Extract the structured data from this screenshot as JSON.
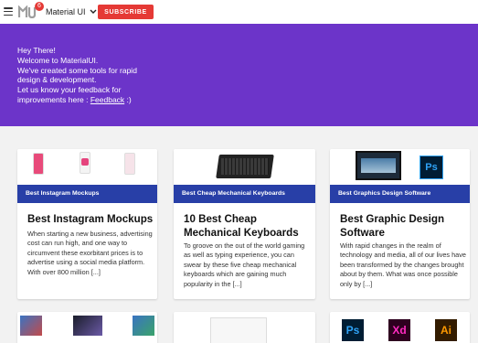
{
  "header": {
    "menu_icon": "hamburger-icon",
    "logo_icon": "mui-logo-icon",
    "badge_count": "6",
    "brand_label": "Material UI",
    "subscribe_label": "SUBSCRIBE",
    "accent_color": "#e53935"
  },
  "hero": {
    "line1": "Hey There!",
    "line2": "Welcome to MaterialUI.",
    "line3": "We've created some tools for rapid",
    "line4": "design & development.",
    "line5": "Let us know your feedback for",
    "line6_prefix": "improvements here : ",
    "feedback_link": "Feedback",
    "line6_suffix": " :)",
    "background": "#6c34c9"
  },
  "cards": [
    {
      "category": "Best Instagram Mockups",
      "title": "Best Instagram Mockups",
      "excerpt": "When starting a new business, advertising cost can run high, and one way to circumvent these exorbitant prices is to advertise using a social media platform. With over 800 million [...]"
    },
    {
      "category": "Best Cheap Mechanical Keyboards",
      "title": "10 Best Cheap Mechanical Keyboards",
      "excerpt": "To groove on the out of the world gaming as well as typing experience, you can swear by these five cheap mechanical keyboards which are gaining much popularity in the [...]"
    },
    {
      "category": "Best Graphics Design Software",
      "title": "Best Graphic Design Software",
      "excerpt": "With rapid changes in the realm of technology and media, all of our lives have been transformed by the changes brought about by them. What was once possible only by [...]"
    }
  ],
  "bottom_cards": {
    "card6_icons": [
      "Ps",
      "Xd",
      "Ai"
    ]
  }
}
